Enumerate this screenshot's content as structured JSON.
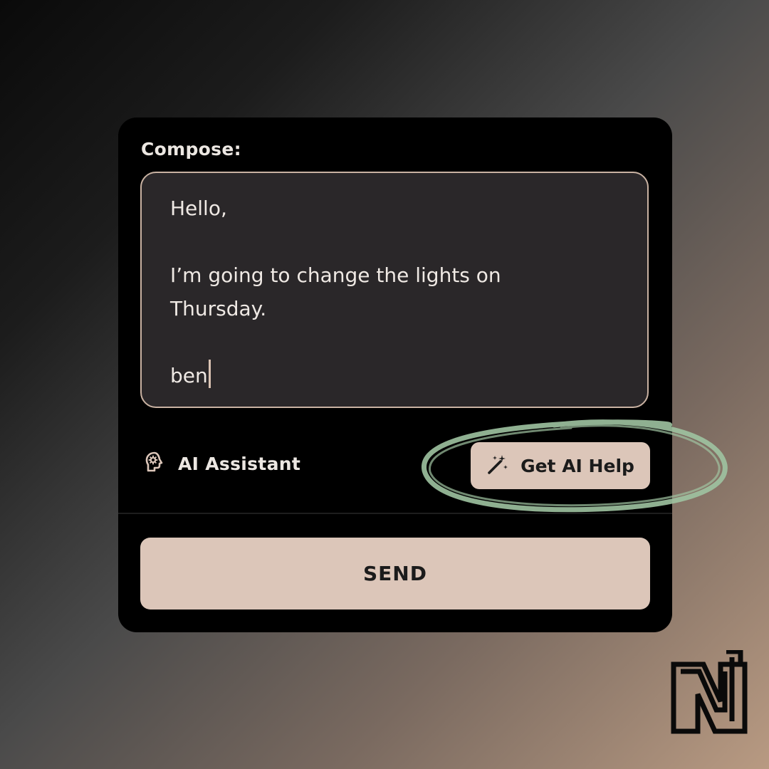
{
  "compose": {
    "label": "Compose:",
    "lines": [
      "Hello,",
      "",
      "I’m going to change the lights on",
      "Thursday.",
      "",
      "ben"
    ]
  },
  "assistant": {
    "icon": "brain-gear-icon",
    "label": "AI Assistant"
  },
  "help_button": {
    "icon": "magic-wand-icon",
    "label": "Get AI Help"
  },
  "send_button": {
    "label": "SEND"
  },
  "colors": {
    "card": "#000000",
    "compose_bg": "#2a2729",
    "accent": "#dcc6b9",
    "highlight": "#9fc3a1"
  }
}
